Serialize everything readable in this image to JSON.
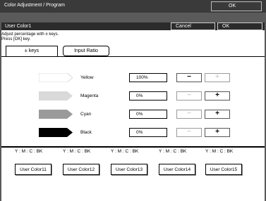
{
  "window": {
    "title": "Color Adjustment / Program",
    "ok_label": "OK"
  },
  "header": {
    "title": "User Color1",
    "cancel_label": "Cancel",
    "ok_label": "OK"
  },
  "instructions": [
    "Adjust percentage with ± keys.",
    "Press [OK] key."
  ],
  "tabs": [
    {
      "label": "± keys",
      "selected": true
    },
    {
      "label": "Input Ratio",
      "selected": false
    }
  ],
  "colors": [
    {
      "name": "Yellow",
      "value": "100%",
      "swatch": "#ffffff",
      "minus_enabled": true,
      "plus_enabled": false
    },
    {
      "name": "Magenta",
      "value": "0%",
      "swatch": "#d9d9d9",
      "minus_enabled": false,
      "plus_enabled": true
    },
    {
      "name": "Cyan",
      "value": "0%",
      "swatch": "#9a9a9a",
      "minus_enabled": false,
      "plus_enabled": true
    },
    {
      "name": "Black",
      "value": "0%",
      "swatch": "#000000",
      "minus_enabled": false,
      "plus_enabled": true
    }
  ],
  "stepper": {
    "minus": "−",
    "plus": "+"
  },
  "presets": [
    {
      "cmyk": "Y : M : C : BK",
      "label": "User Color11"
    },
    {
      "cmyk": "Y : M : C : BK",
      "label": "User Color12"
    },
    {
      "cmyk": "Y : M : C : BK",
      "label": "User Color13"
    },
    {
      "cmyk": "Y : M : C : BK",
      "label": "User Color14"
    },
    {
      "cmyk": "Y : M : C : BK",
      "label": "User Color15"
    }
  ]
}
